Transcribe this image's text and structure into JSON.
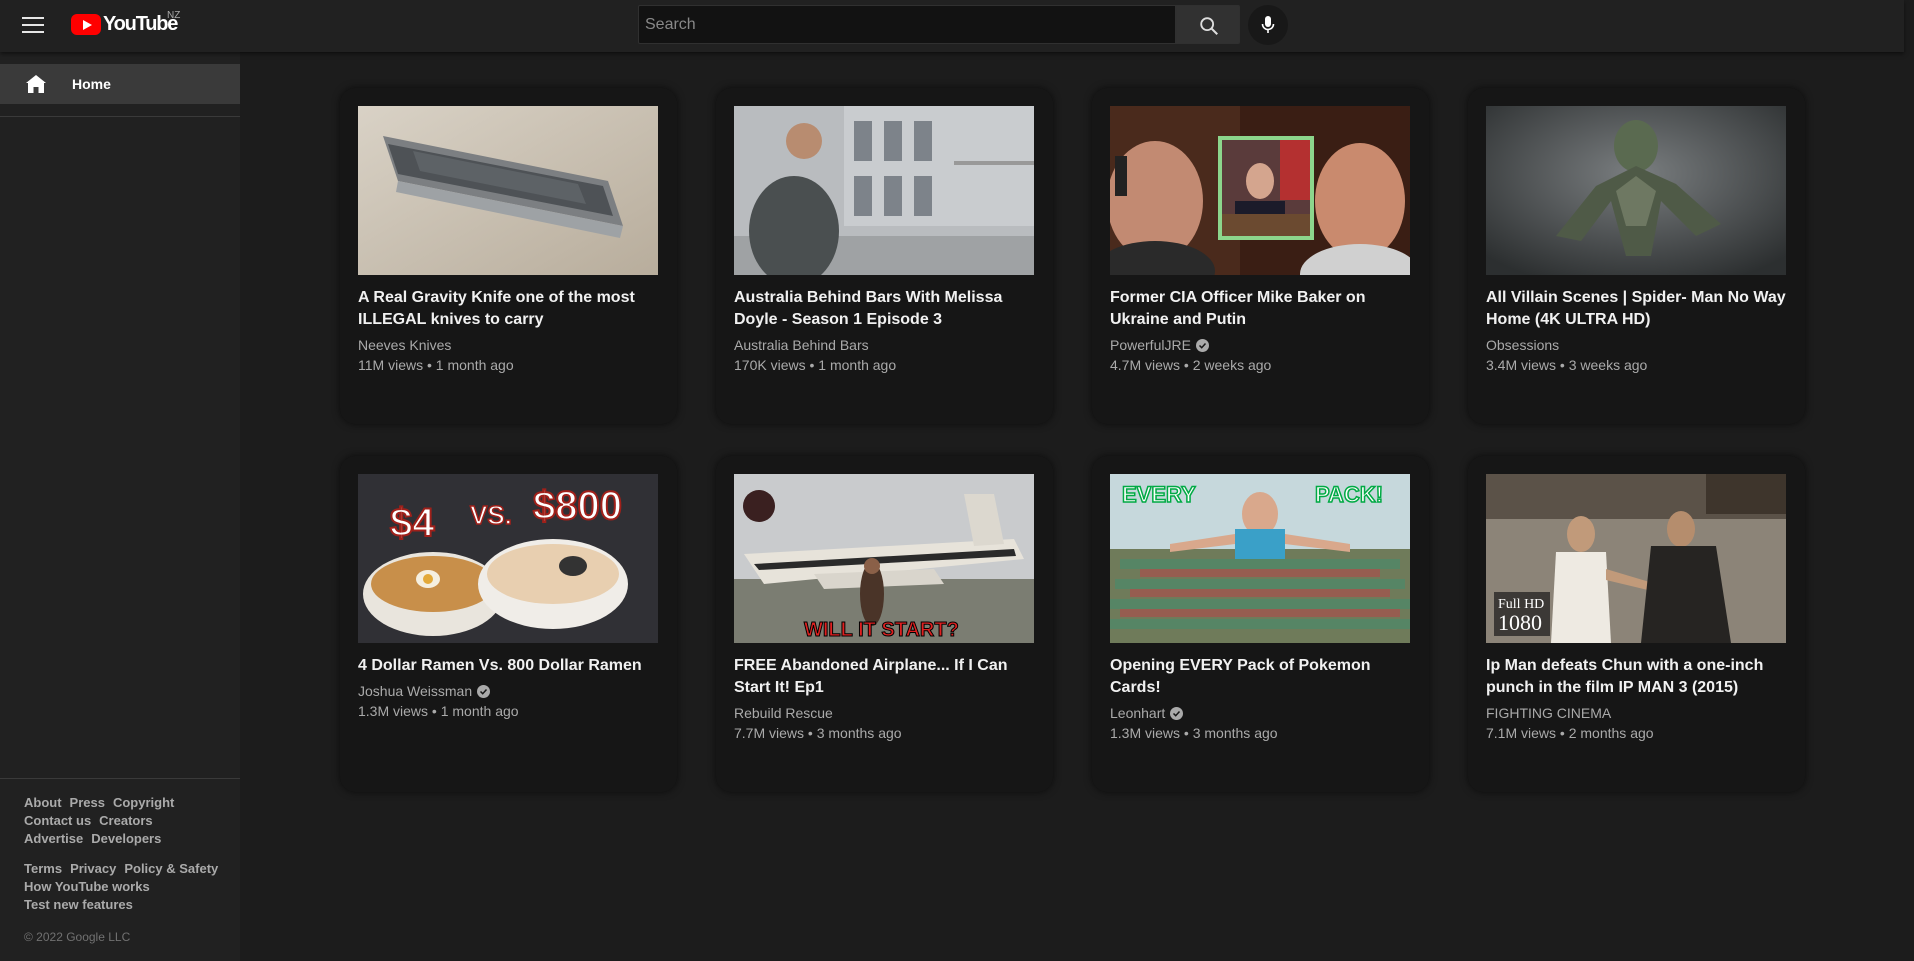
{
  "header": {
    "logo_text": "YouTube",
    "region": "NZ",
    "search_placeholder": "Search"
  },
  "sidebar": {
    "home_label": "Home",
    "footer_links_1": [
      "About",
      "Press",
      "Copyright",
      "Contact us",
      "Creators",
      "Advertise",
      "Developers"
    ],
    "footer_links_2": [
      "Terms",
      "Privacy",
      "Policy & Safety",
      "How YouTube works",
      "Test new features"
    ],
    "copyright": "© 2022 Google LLC"
  },
  "videos": [
    {
      "title": "A Real Gravity Knife one of the most ILLEGAL knives to carry",
      "channel": "Neeves Knives",
      "verified": false,
      "views": "11M views",
      "age": "1 month ago"
    },
    {
      "title": "Australia Behind Bars With Melissa Doyle - Season 1 Episode 3",
      "channel": "Australia Behind Bars",
      "verified": false,
      "views": "170K views",
      "age": "1 month ago"
    },
    {
      "title": "Former CIA Officer Mike Baker on Ukraine and Putin",
      "channel": "PowerfulJRE",
      "verified": true,
      "views": "4.7M views",
      "age": "2 weeks ago"
    },
    {
      "title": "All Villain Scenes | Spider- Man No Way Home (4K ULTRA HD)",
      "channel": "Obsessions",
      "verified": false,
      "views": "3.4M views",
      "age": "3 weeks ago"
    },
    {
      "title": "4 Dollar Ramen Vs. 800 Dollar Ramen",
      "channel": "Joshua Weissman",
      "verified": true,
      "views": "1.3M views",
      "age": "1 month ago"
    },
    {
      "title": "FREE Abandoned Airplane... If I Can Start It! Ep1",
      "channel": "Rebuild Rescue",
      "verified": false,
      "views": "7.7M views",
      "age": "3 months ago"
    },
    {
      "title": "Opening EVERY Pack of Pokemon Cards!",
      "channel": "Leonhart",
      "verified": true,
      "views": "1.3M views",
      "age": "3 months ago"
    },
    {
      "title": "Ip Man defeats Chun with a one-inch punch in the film IP MAN 3 (2015)",
      "channel": "FIGHTING CINEMA",
      "verified": false,
      "views": "7.1M views",
      "age": "2 months ago"
    }
  ],
  "thumbnail_text": {
    "ramen_left": "$4",
    "ramen_vs": "VS.",
    "ramen_right": "$800",
    "airplane": "WILL IT START?",
    "pokemon_left": "EVERY",
    "pokemon_right": "PACK!",
    "ipman_badge_1": "Full HD",
    "ipman_badge_2": "1080"
  },
  "colors": {
    "accent": "#ff0000",
    "background": "#1c1c1c",
    "card": "#161616"
  }
}
